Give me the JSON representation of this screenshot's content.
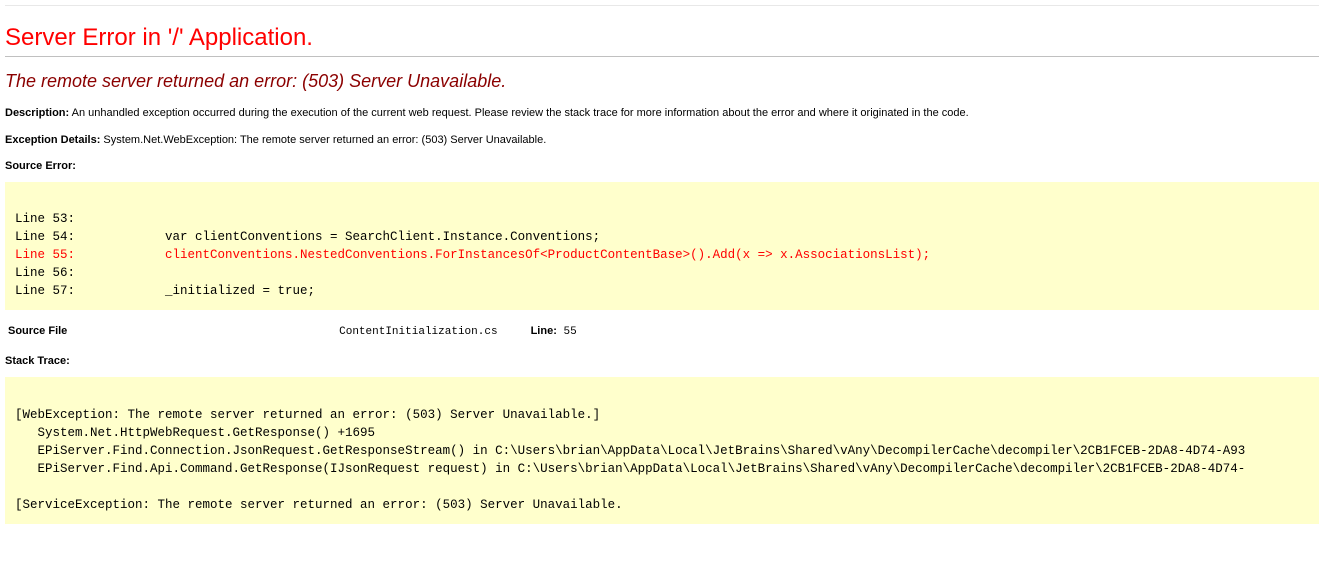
{
  "page_title": "Server Error in '/' Application.",
  "error_heading": "The remote server returned an error: (503) Server Unavailable.",
  "description_label": "Description:",
  "description_text": "An unhandled exception occurred during the execution of the current web request. Please review the stack trace for more information about the error and where it originated in the code.",
  "exception_details_label": "Exception Details:",
  "exception_details_text": "System.Net.WebException: The remote server returned an error: (503) Server Unavailable.",
  "source_error_label": "Source Error:",
  "source_lines": [
    {
      "n": "Line 53:",
      "code": "",
      "hl": false
    },
    {
      "n": "Line 54:",
      "code": "            var clientConventions = SearchClient.Instance.Conventions;",
      "hl": false
    },
    {
      "n": "Line 55:",
      "code": "            clientConventions.NestedConventions.ForInstancesOf<ProductContentBase>().Add(x => x.AssociationsList);",
      "hl": true
    },
    {
      "n": "Line 56:",
      "code": "",
      "hl": false
    },
    {
      "n": "Line 57:",
      "code": "            _initialized = true;",
      "hl": false
    }
  ],
  "source_file_label": "Source File",
  "source_file_value": "ContentInitialization.cs",
  "line_label": "Line:",
  "line_value": "55",
  "stack_trace_label": "Stack Trace:",
  "stack_trace_text": "\n[WebException: The remote server returned an error: (503) Server Unavailable.]\n   System.Net.HttpWebRequest.GetResponse() +1695\n   EPiServer.Find.Connection.JsonRequest.GetResponseStream() in C:\\Users\\brian\\AppData\\Local\\JetBrains\\Shared\\vAny\\DecompilerCache\\decompiler\\2CB1FCEB-2DA8-4D74-A93\n   EPiServer.Find.Api.Command.GetResponse(IJsonRequest request) in C:\\Users\\brian\\AppData\\Local\\JetBrains\\Shared\\vAny\\DecompilerCache\\decompiler\\2CB1FCEB-2DA8-4D74-\n\n[ServiceException: The remote server returned an error: (503) Server Unavailable."
}
